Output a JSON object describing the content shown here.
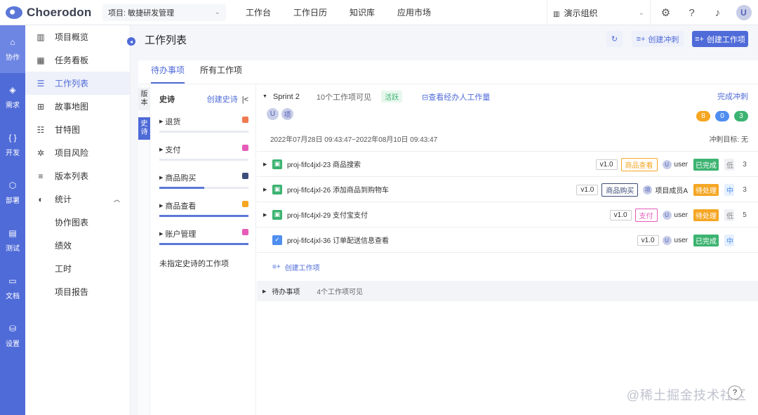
{
  "app": {
    "logo_text": "Choerodon"
  },
  "topbar": {
    "project": "项目: 敏捷研发管理",
    "nav": [
      "工作台",
      "工作日历",
      "知识库",
      "应用市场"
    ],
    "org": "演示组织",
    "avatar": "U"
  },
  "leftnav": [
    {
      "label": "协作",
      "icon": "cooperation-icon",
      "glyph": "⌂"
    },
    {
      "label": "需求",
      "icon": "layers-icon",
      "glyph": "◈"
    },
    {
      "label": "开发",
      "icon": "code-icon",
      "glyph": "{ }"
    },
    {
      "label": "部署",
      "icon": "deploy-icon",
      "glyph": "⬡"
    },
    {
      "label": "测试",
      "icon": "test-icon",
      "glyph": "▤"
    },
    {
      "label": "文档",
      "icon": "document-icon",
      "glyph": "▭"
    },
    {
      "label": "设置",
      "icon": "settings-icon",
      "glyph": "⛁"
    }
  ],
  "menu": {
    "items": [
      {
        "label": "项目概览",
        "icon": "chart-icon",
        "glyph": "▥"
      },
      {
        "label": "任务看板",
        "icon": "board-icon",
        "glyph": "▦"
      },
      {
        "label": "工作列表",
        "icon": "list-icon",
        "glyph": "☰"
      },
      {
        "label": "故事地图",
        "icon": "map-icon",
        "glyph": "⊞"
      },
      {
        "label": "甘特图",
        "icon": "gantt-icon",
        "glyph": "☷"
      },
      {
        "label": "项目风险",
        "icon": "risk-icon",
        "glyph": "✲"
      },
      {
        "label": "版本列表",
        "icon": "version-icon",
        "glyph": "≡"
      }
    ],
    "stats": {
      "label": "统计",
      "glyph": "◐"
    },
    "sub": [
      "协作图表",
      "绩效",
      "工时",
      "项目报告"
    ]
  },
  "page": {
    "title": "工作列表",
    "btn_sprint": "创建冲刺",
    "btn_create": "创建工作项",
    "tabs": [
      "待办事项",
      "所有工作项"
    ],
    "vtab_version": "版本",
    "vtab_epic": "史诗"
  },
  "epics": {
    "title": "史诗",
    "create": "创建史诗",
    "list": [
      {
        "name": "退货",
        "color": "#ef7a4f",
        "progress": 0
      },
      {
        "name": "支付",
        "color": "#e65bb8",
        "progress": 0
      },
      {
        "name": "商品购买",
        "color": "#3d4e7a",
        "progress": 0.5
      },
      {
        "name": "商品查看",
        "color": "#f5a623",
        "progress": 1
      },
      {
        "name": "账户管理",
        "color": "#e65bb8",
        "progress": 1
      }
    ],
    "unassigned": "未指定史诗的工作项"
  },
  "sprint": {
    "name": "Sprint 2",
    "count": "10个工作项可见",
    "status": "活跃",
    "view_workload": "查看经办人工作量",
    "complete": "完成冲刺",
    "members": [
      "U",
      "项"
    ],
    "counts": [
      {
        "value": "8",
        "color": "#f5a623"
      },
      {
        "value": "0",
        "color": "#4f8ef0"
      },
      {
        "value": "3",
        "color": "#3cb371"
      }
    ],
    "dates": "2022年07月28日 09:43:47~2022年08月10日 09:43:47",
    "goal": "冲刺目标: 无"
  },
  "issues": [
    {
      "key": "proj-fifc4jxl-23",
      "summary": "商品搜索",
      "done": true,
      "type": "story",
      "version": "v1.0",
      "epic": "商品查看",
      "epic_color": "#f5a623",
      "assignee_avatar": "U",
      "assignee": "user",
      "status": "已完成",
      "status_color": "#3cb371",
      "priority": "低",
      "points": "3"
    },
    {
      "key": "proj-fifc4jxl-26",
      "summary": "添加商品到购物车",
      "done": false,
      "type": "story",
      "version": "v1.0",
      "epic": "商品购买",
      "epic_color": "#3d4e7a",
      "assignee_avatar": "项",
      "assignee": "项目成员A",
      "status": "待处理",
      "status_color": "#f5a623",
      "priority": "中",
      "points": "3"
    },
    {
      "key": "proj-fifc4jxl-29",
      "summary": "支付宝支付",
      "done": false,
      "type": "story",
      "version": "v1.0",
      "epic": "支付",
      "epic_color": "#e65bb8",
      "assignee_avatar": "U",
      "assignee": "user",
      "status": "待处理",
      "status_color": "#f5a623",
      "priority": "低",
      "points": "5"
    },
    {
      "key": "proj-fifc4jxl-36",
      "summary": "订单配送信息查看",
      "done": true,
      "type": "task",
      "version": "v1.0",
      "epic": "",
      "epic_color": "",
      "assignee_avatar": "U",
      "assignee": "user",
      "status": "已完成",
      "status_color": "#3cb371",
      "priority": "中",
      "points": ""
    }
  ],
  "create_issue": "创建工作项",
  "backlog": {
    "name": "待办事项",
    "count": "4个工作项可见"
  },
  "watermark": "@稀土掘金技术社区"
}
